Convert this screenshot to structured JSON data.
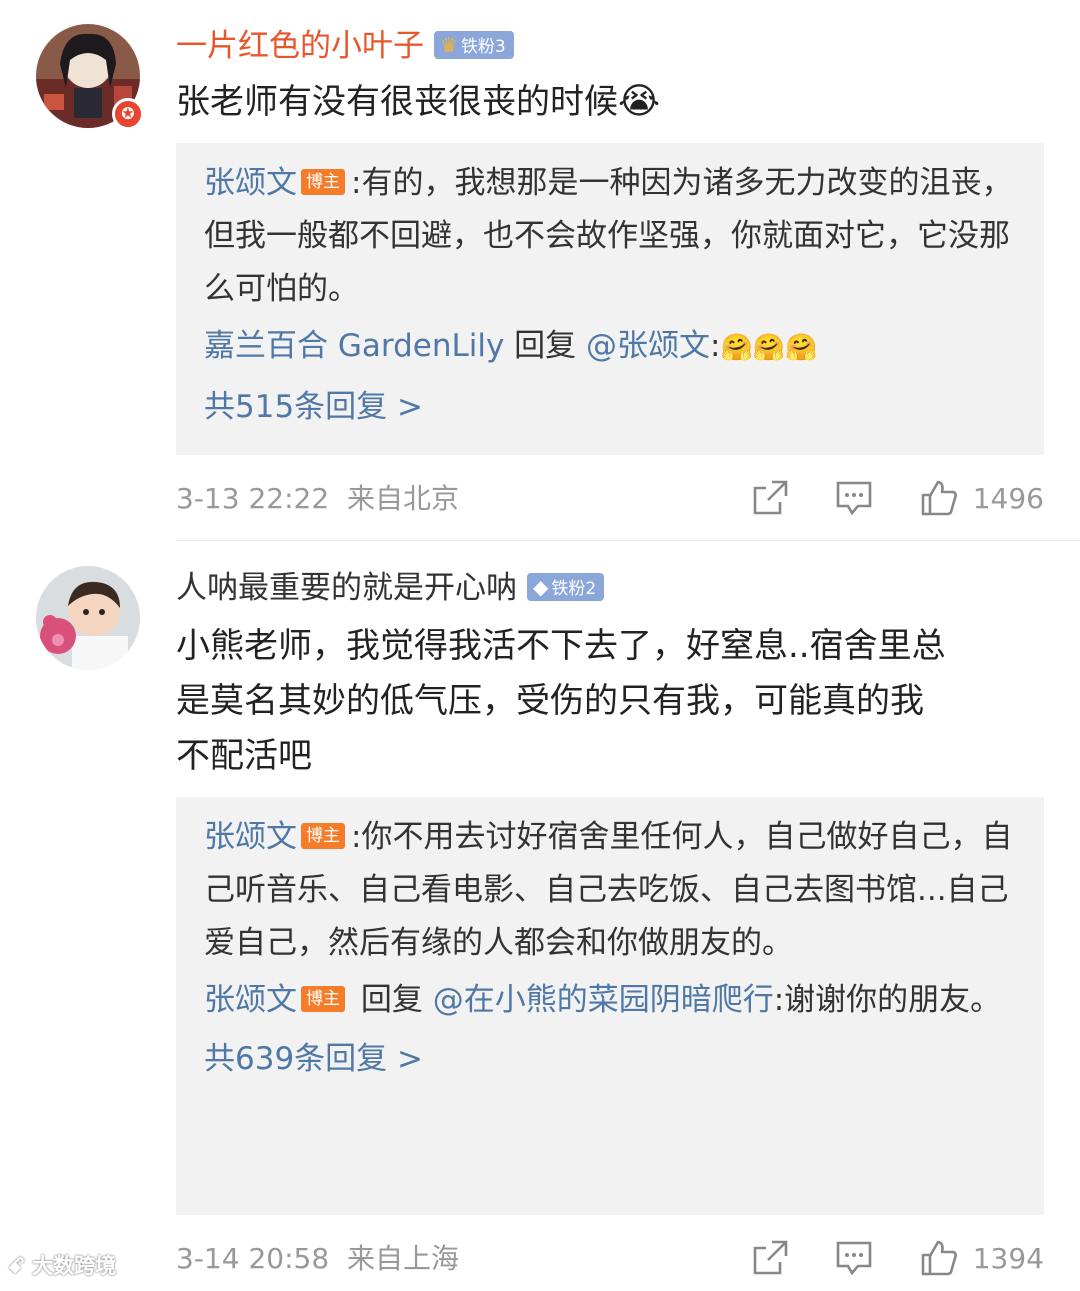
{
  "comments": [
    {
      "username": "一片红色的小叶子",
      "fan_badge": "铁粉3",
      "text": "张老师有没有很丧很丧的时候",
      "emoji": "😭",
      "replies": [
        {
          "author": "张颂文",
          "author_badge": "博主",
          "text": ":有的，我想那是一种因为诸多无力改变的沮丧，但我一般都不回避，也不会故作坚强，你就面对它，它没那么可怕的。"
        },
        {
          "author": "嘉兰百合 GardenLily",
          "reply_word": "回复",
          "mention": "@张颂文",
          "text": ":"
        }
      ],
      "more_replies": "共515条回复 >",
      "time": "3-13 22:22",
      "location": "来自北京",
      "likes": "1496"
    },
    {
      "username": "人呐最重要的就是开心呐",
      "fan_badge": "铁粉2",
      "text_lines": [
        "小熊老师，我觉得我活不下去了，好窒息..宿舍里总",
        "是莫名其妙的低气压，受伤的只有我，可能真的我",
        "不配活吧"
      ],
      "replies": [
        {
          "author": "张颂文",
          "author_badge": "博主",
          "text": ":你不用去讨好宿舍里任何人，自己做好自己，自己听音乐、自己看电影、自己去吃饭、自己去图书馆...自己爱自己，然后有缘的人都会和你做朋友的。"
        },
        {
          "author": "张颂文",
          "author_badge": "博主",
          "reply_word": "回复",
          "mention": "@在小熊的菜园阴暗爬行",
          "text": ":谢谢你的朋友。"
        }
      ],
      "more_replies": "共639条回复 >",
      "time": "3-14 20:58",
      "location": "来自上海",
      "likes": "1394"
    }
  ],
  "watermark": "大数跨境",
  "colors": {
    "link": "#4f78a6",
    "red_name": "#e8562a",
    "meta": "#999999",
    "reply_bg": "#f2f2f2",
    "badge_orange": "#f57c29"
  },
  "icons": [
    "share-icon",
    "comment-icon",
    "like-icon",
    "crown-icon",
    "diamond-icon",
    "verified-badge-icon"
  ]
}
